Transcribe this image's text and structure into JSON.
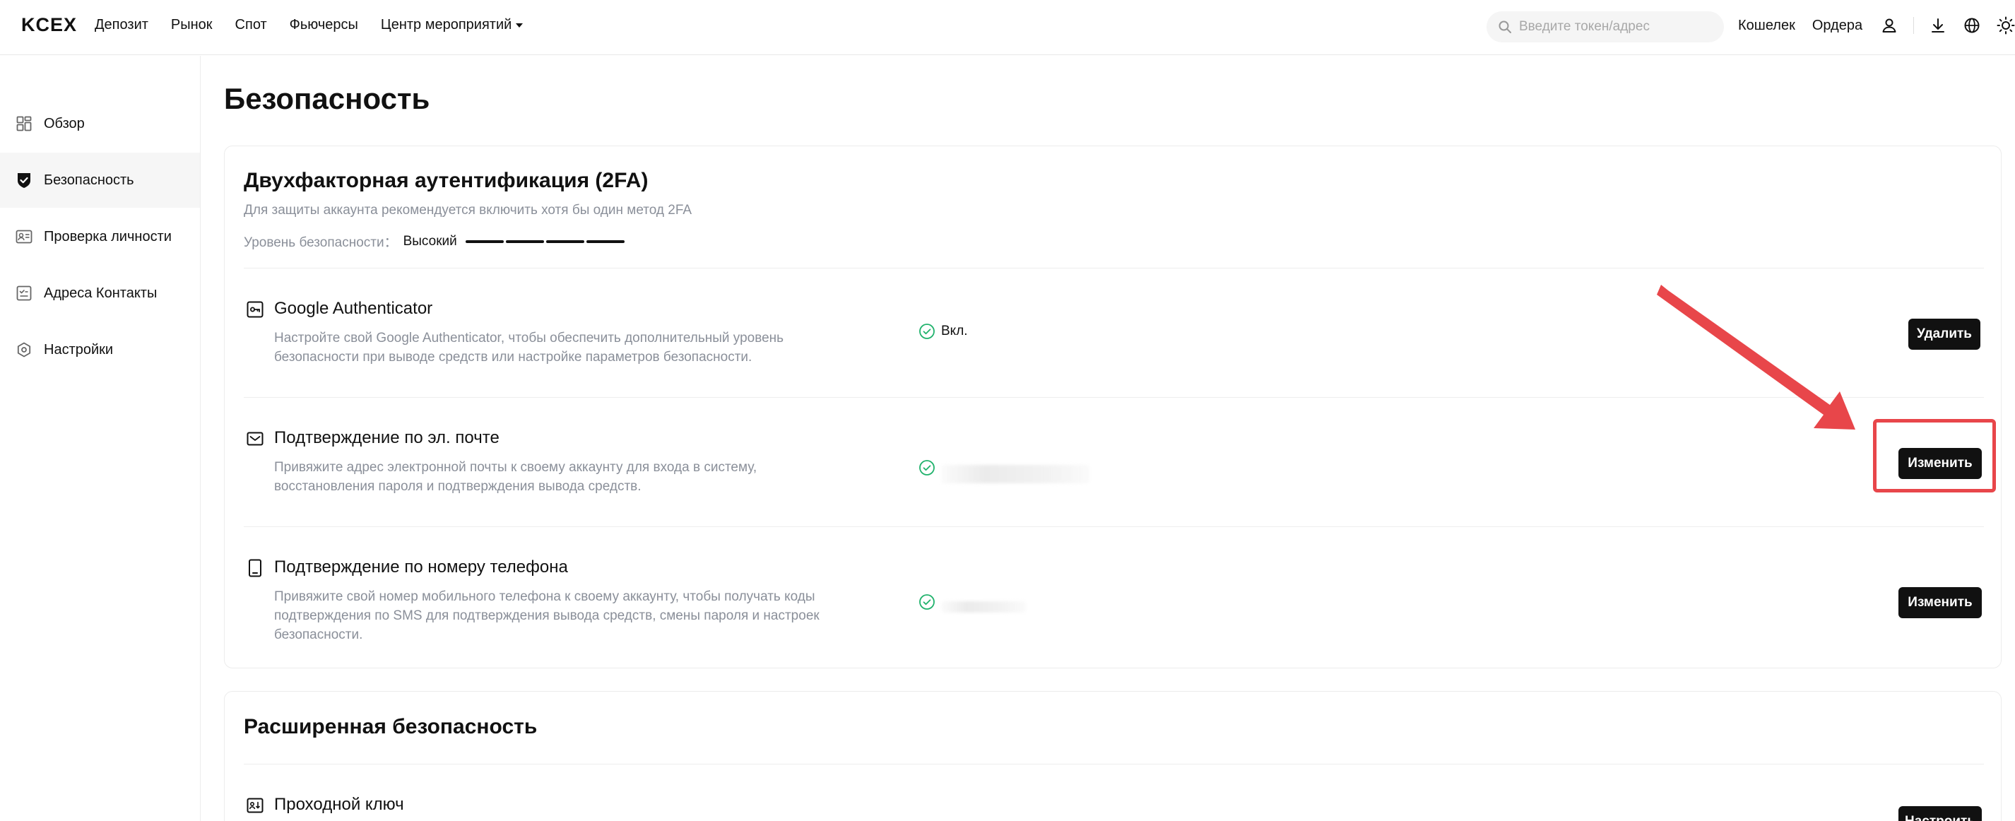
{
  "header": {
    "logo": "KCEX",
    "nav": [
      "Депозит",
      "Рынок",
      "Спот",
      "Фьючерсы",
      "Центр мероприятий"
    ],
    "search_placeholder": "Введите токен/адрес",
    "wallet": "Кошелек",
    "orders": "Ордера",
    "icons": [
      "user-icon",
      "download-icon",
      "globe-icon",
      "sun-icon"
    ]
  },
  "sidebar": {
    "items": [
      {
        "label": "Обзор",
        "icon": "overview-icon"
      },
      {
        "label": "Безопасность",
        "icon": "shield-icon",
        "active": true
      },
      {
        "label": "Проверка личности",
        "icon": "id-card-icon"
      },
      {
        "label": "Адреса Контакты",
        "icon": "address-book-icon"
      },
      {
        "label": "Настройки",
        "icon": "settings-icon"
      }
    ]
  },
  "page": {
    "title": "Безопасность"
  },
  "twofa": {
    "title": "Двухфакторная аутентификация (2FA)",
    "subtitle": "Для защиты аккаунта рекомендуется включить хотя бы один метод 2FA",
    "level_label": "Уровень безопасности：",
    "level_value": "Высокий",
    "level_bars_filled": 4,
    "rows": [
      {
        "title": "Google Authenticator",
        "desc1": "Настройте свой Google Authenticator, чтобы обеспечить дополнительный уровень",
        "desc2": "безопасности при выводе средств или настройке параметров безопасности.",
        "status": "Вкл.",
        "button": "Удалить",
        "icon": "authenticator-icon"
      },
      {
        "title": "Подтверждение по эл. почте",
        "desc1": "Привяжите адрес электронной почты к своему аккаунту для входа в систему,",
        "desc2": "восстановления пароля и подтверждения вывода средств.",
        "status": "",
        "button": "Изменить",
        "icon": "mail-icon"
      },
      {
        "title": "Подтверждение по номеру телефона",
        "desc1": "Привяжите свой номер мобильного телефона к своему аккаунту, чтобы получать коды",
        "desc2": "подтверждения по SMS для подтверждения вывода средств, смены пароля и настроек",
        "desc3": "безопасности.",
        "status": "",
        "button": "Изменить",
        "icon": "phone-icon"
      }
    ]
  },
  "advanced": {
    "title": "Расширенная безопасность",
    "rows": [
      {
        "title": "Проходной ключ",
        "button": "Настроить",
        "icon": "passkey-icon"
      }
    ]
  },
  "annotation": {
    "color": "#e8464a"
  }
}
